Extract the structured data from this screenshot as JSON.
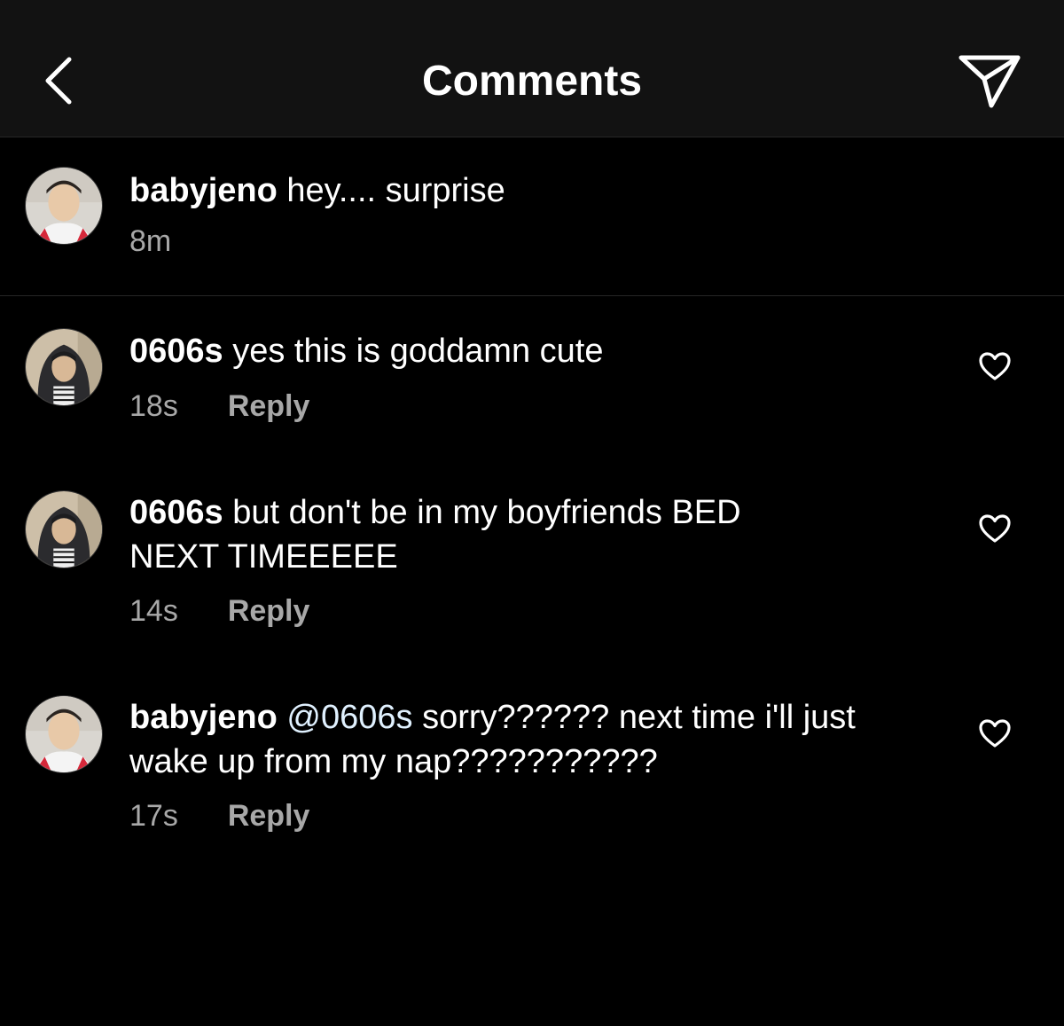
{
  "header": {
    "title": "Comments",
    "back_icon": "chevron-left-icon",
    "send_icon": "paper-plane-icon"
  },
  "caption": {
    "username": "babyjeno",
    "text": "hey.... surprise",
    "time": "8m"
  },
  "comments": [
    {
      "username": "0606s",
      "text": "yes this is goddamn cute",
      "time": "18s",
      "reply_label": "Reply"
    },
    {
      "username": "0606s",
      "line1": "but don't be in my boyfriends BED",
      "line2": "NEXT TIMEEEEE",
      "time": "14s",
      "reply_label": "Reply"
    },
    {
      "username": "babyjeno",
      "mention": "@0606s",
      "line1": "sorry?????? next time i'll just",
      "line2": "wake up from my nap???????????",
      "time": "17s",
      "reply_label": "Reply"
    }
  ],
  "colors": {
    "background": "#000000",
    "header": "#121212",
    "secondary_text": "#a8a8a8",
    "divider": "#262626"
  }
}
